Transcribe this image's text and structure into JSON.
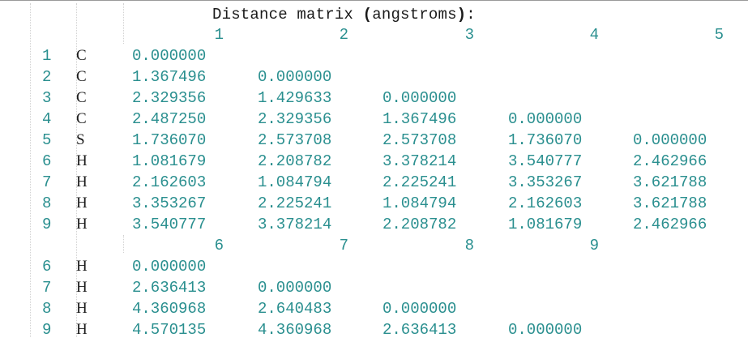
{
  "title": {
    "prefix": "Distance matrix ",
    "open": "(",
    "unit": "angstroms",
    "close": ")",
    "suffix": ":"
  },
  "blocks": [
    {
      "headers": [
        "1",
        "2",
        "3",
        "4",
        "5"
      ],
      "rows": [
        {
          "index": "1",
          "element": "C",
          "values": [
            "0.000000"
          ]
        },
        {
          "index": "2",
          "element": "C",
          "values": [
            "1.367496",
            "0.000000"
          ]
        },
        {
          "index": "3",
          "element": "C",
          "values": [
            "2.329356",
            "1.429633",
            "0.000000"
          ]
        },
        {
          "index": "4",
          "element": "C",
          "values": [
            "2.487250",
            "2.329356",
            "1.367496",
            "0.000000"
          ]
        },
        {
          "index": "5",
          "element": "S",
          "values": [
            "1.736070",
            "2.573708",
            "2.573708",
            "1.736070",
            "0.000000"
          ]
        },
        {
          "index": "6",
          "element": "H",
          "values": [
            "1.081679",
            "2.208782",
            "3.378214",
            "3.540777",
            "2.462966"
          ]
        },
        {
          "index": "7",
          "element": "H",
          "values": [
            "2.162603",
            "1.084794",
            "2.225241",
            "3.353267",
            "3.621788"
          ]
        },
        {
          "index": "8",
          "element": "H",
          "values": [
            "3.353267",
            "2.225241",
            "1.084794",
            "2.162603",
            "3.621788"
          ]
        },
        {
          "index": "9",
          "element": "H",
          "values": [
            "3.540777",
            "3.378214",
            "2.208782",
            "1.081679",
            "2.462966"
          ]
        }
      ]
    },
    {
      "headers": [
        "6",
        "7",
        "8",
        "9"
      ],
      "rows": [
        {
          "index": "6",
          "element": "H",
          "values": [
            "0.000000"
          ]
        },
        {
          "index": "7",
          "element": "H",
          "values": [
            "2.636413",
            "0.000000"
          ]
        },
        {
          "index": "8",
          "element": "H",
          "values": [
            "4.360968",
            "2.640483",
            "0.000000"
          ]
        },
        {
          "index": "9",
          "element": "H",
          "values": [
            "4.570135",
            "4.360968",
            "2.636413",
            "0.000000"
          ]
        }
      ]
    }
  ]
}
